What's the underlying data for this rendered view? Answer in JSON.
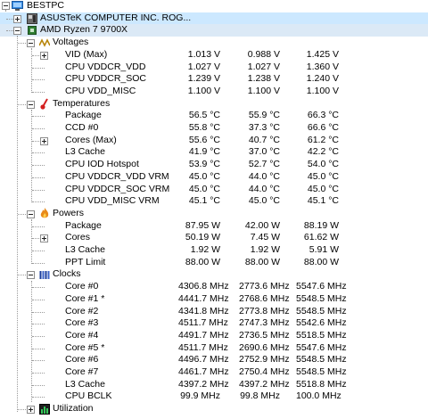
{
  "root": {
    "label": "BESTPC"
  },
  "devices": [
    {
      "label": "ASUSTeK COMPUTER INC. ROG..."
    },
    {
      "label": "AMD Ryzen 7 9700X"
    }
  ],
  "sections": {
    "voltages": {
      "label": "Voltages",
      "rows": [
        {
          "label": "VID (Max)",
          "expandable": true,
          "value": "1.013 V",
          "min": "0.988 V",
          "max": "1.425 V"
        },
        {
          "label": "CPU VDDCR_VDD",
          "value": "1.027 V",
          "min": "1.027 V",
          "max": "1.360 V"
        },
        {
          "label": "CPU VDDCR_SOC",
          "value": "1.239 V",
          "min": "1.238 V",
          "max": "1.240 V"
        },
        {
          "label": "CPU VDD_MISC",
          "value": "1.100 V",
          "min": "1.100 V",
          "max": "1.100 V"
        }
      ]
    },
    "temperatures": {
      "label": "Temperatures",
      "rows": [
        {
          "label": "Package",
          "value": "56.5 °C",
          "min": "55.9 °C",
          "max": "66.3 °C"
        },
        {
          "label": "CCD #0",
          "value": "55.8 °C",
          "min": "37.3 °C",
          "max": "66.6 °C"
        },
        {
          "label": "Cores (Max)",
          "expandable": true,
          "value": "55.6 °C",
          "min": "40.7 °C",
          "max": "61.2 °C"
        },
        {
          "label": "L3 Cache",
          "value": "41.9 °C",
          "min": "37.0 °C",
          "max": "42.2 °C"
        },
        {
          "label": "CPU IOD Hotspot",
          "value": "53.9 °C",
          "min": "52.7 °C",
          "max": "54.0 °C"
        },
        {
          "label": "CPU VDDCR_VDD VRM",
          "value": "45.0 °C",
          "min": "44.0 °C",
          "max": "45.0 °C"
        },
        {
          "label": "CPU VDDCR_SOC VRM",
          "value": "45.0 °C",
          "min": "44.0 °C",
          "max": "45.0 °C"
        },
        {
          "label": "CPU VDD_MISC VRM",
          "value": "45.1 °C",
          "min": "45.0 °C",
          "max": "45.1 °C"
        }
      ]
    },
    "powers": {
      "label": "Powers",
      "rows": [
        {
          "label": "Package",
          "value": "87.95 W",
          "min": "42.00 W",
          "max": "88.19 W"
        },
        {
          "label": "Cores",
          "expandable": true,
          "value": "50.19 W",
          "min": "7.45 W",
          "max": "61.62 W"
        },
        {
          "label": "L3 Cache",
          "value": "1.92 W",
          "min": "1.92 W",
          "max": "5.91 W"
        },
        {
          "label": "PPT Limit",
          "value": "88.00 W",
          "min": "88.00 W",
          "max": "88.00 W"
        }
      ]
    },
    "clocks": {
      "label": "Clocks",
      "rows": [
        {
          "label": "Core #0",
          "value": "4306.8 MHz",
          "min": "2773.6 MHz",
          "max": "5547.6 MHz"
        },
        {
          "label": "Core #1 *",
          "value": "4441.7 MHz",
          "min": "2768.6 MHz",
          "max": "5548.5 MHz"
        },
        {
          "label": "Core #2",
          "value": "4341.8 MHz",
          "min": "2773.8 MHz",
          "max": "5548.5 MHz"
        },
        {
          "label": "Core #3",
          "value": "4511.7 MHz",
          "min": "2747.3 MHz",
          "max": "5542.6 MHz"
        },
        {
          "label": "Core #4",
          "value": "4491.7 MHz",
          "min": "2736.5 MHz",
          "max": "5518.5 MHz"
        },
        {
          "label": "Core #5 *",
          "value": "4511.7 MHz",
          "min": "2690.6 MHz",
          "max": "5547.6 MHz"
        },
        {
          "label": "Core #6",
          "value": "4496.7 MHz",
          "min": "2752.9 MHz",
          "max": "5548.5 MHz"
        },
        {
          "label": "Core #7",
          "value": "4461.7 MHz",
          "min": "2750.4 MHz",
          "max": "5548.5 MHz"
        },
        {
          "label": "L3 Cache",
          "value": "4397.2 MHz",
          "min": "4397.2 MHz",
          "max": "5518.8 MHz"
        },
        {
          "label": "CPU BCLK",
          "value": "99.9 MHz",
          "min": "99.8 MHz",
          "max": "100.0 MHz"
        }
      ]
    },
    "utilization": {
      "label": "Utilization"
    }
  },
  "icons": {
    "root": "computer-icon",
    "motherboard": "motherboard-icon",
    "cpu": "cpu-chip-icon",
    "voltages": "voltage-wave-icon",
    "temperatures": "thermometer-icon",
    "powers": "flame-icon",
    "clocks": "clock-bars-icon",
    "utilization": "utilization-bars-icon"
  },
  "colors": {
    "selected_row": "#cce8ff",
    "device_row": "#dbe9f6",
    "voltage_icon": "#b8860b",
    "temperature_icon": "#d42020",
    "power_icon": "#e88a1a",
    "clock_icon": "#1a3d9a"
  }
}
